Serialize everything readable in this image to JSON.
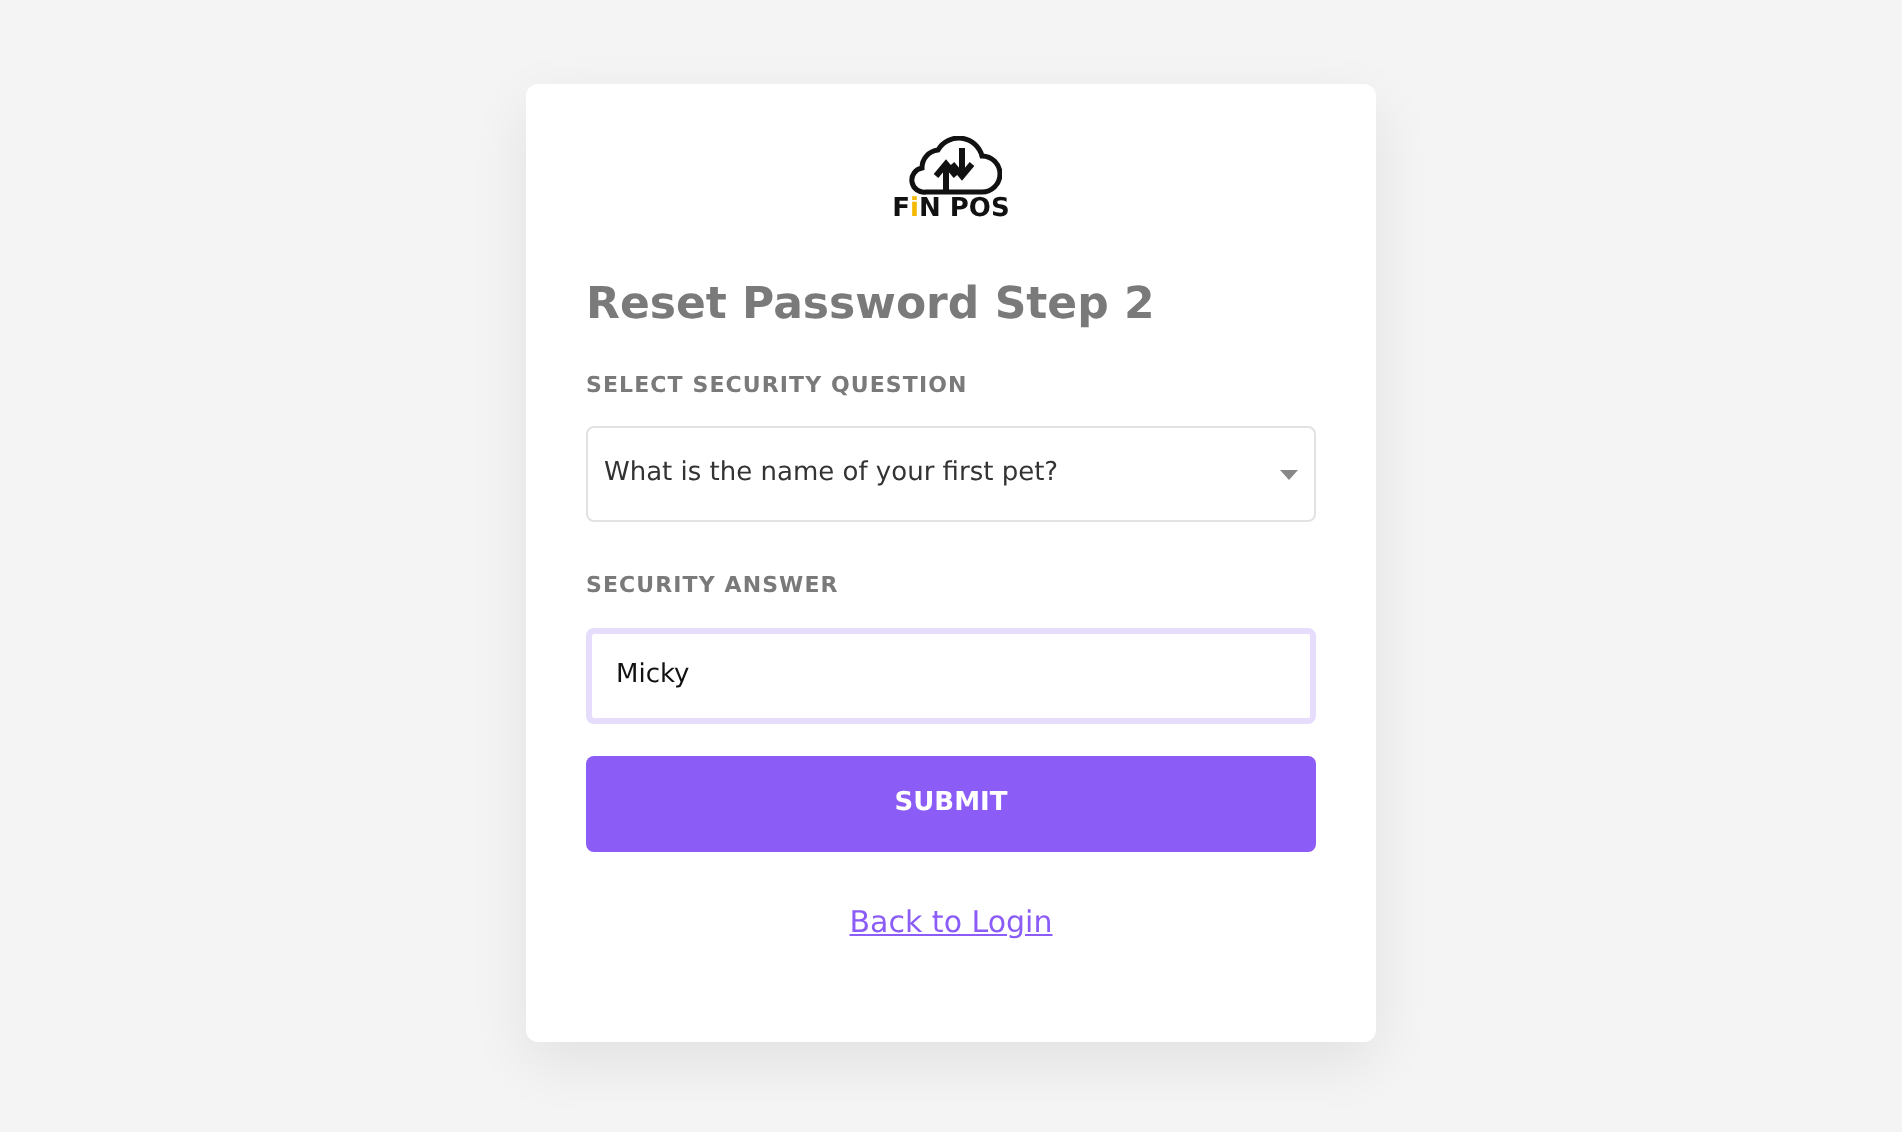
{
  "logo": {
    "parts": [
      {
        "text": "F",
        "accent": false
      },
      {
        "text": "i",
        "accent": true
      },
      {
        "text": "N POS",
        "accent": false
      }
    ]
  },
  "title": "Reset Password Step 2",
  "question_field": {
    "label": "SELECT SECURITY QUESTION",
    "value": "What is the name of your first pet?"
  },
  "answer_field": {
    "label": "SECURITY ANSWER",
    "value": "Micky",
    "focused": true
  },
  "submit_button": "SUBMIT",
  "back_link": "Back to Login"
}
